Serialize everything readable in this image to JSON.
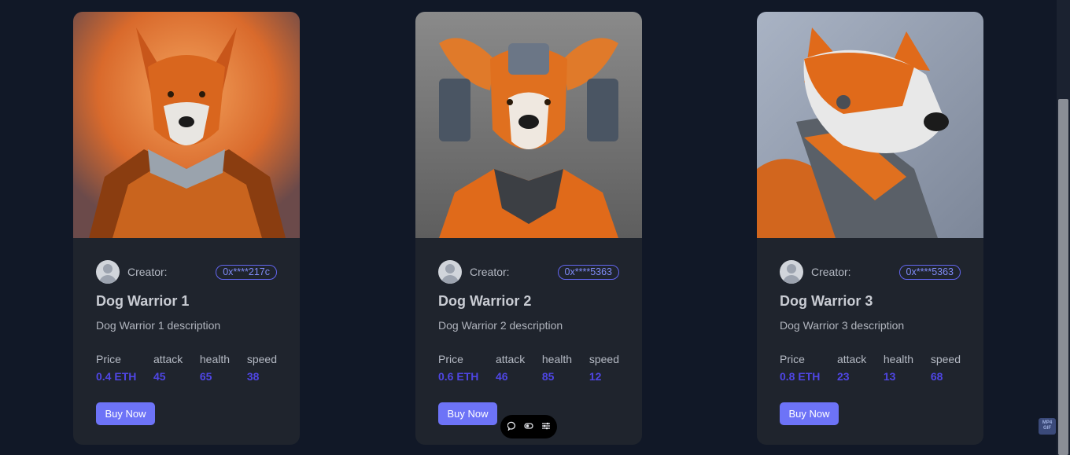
{
  "creator_label": "Creator:",
  "card_1": {
    "address": "0x****217c",
    "title": "Dog Warrior 1",
    "description": "Dog Warrior 1 description",
    "price_label": "Price",
    "price": "0.4 ETH",
    "attack_label": "attack",
    "attack": "45",
    "health_label": "health",
    "health": "65",
    "speed_label": "speed",
    "speed": "38",
    "button": "Buy Now"
  },
  "card_2": {
    "address": "0x****5363",
    "title": "Dog Warrior 2",
    "description": "Dog Warrior 2 description",
    "price_label": "Price",
    "price": "0.6 ETH",
    "attack_label": "attack",
    "attack": "46",
    "health_label": "health",
    "health": "85",
    "speed_label": "speed",
    "speed": "12",
    "button": "Buy Now"
  },
  "card_3": {
    "address": "0x****5363",
    "title": "Dog Warrior 3",
    "description": "Dog Warrior 3 description",
    "price_label": "Price",
    "price": "0.8 ETH",
    "attack_label": "attack",
    "attack": "23",
    "health_label": "health",
    "health": "13",
    "speed_label": "speed",
    "speed": "68",
    "button": "Buy Now"
  },
  "toolbar": {
    "icons": [
      "chat-icon",
      "toggle-icon",
      "sliders-icon"
    ]
  },
  "mp4_badge": {
    "line1": "MP4",
    "line2": "GIF"
  },
  "colors": {
    "background": "#111827",
    "card": "#1f242d",
    "accent": "#6d73f7",
    "stat_value": "#4f46e5",
    "address_border": "#6366f1"
  }
}
